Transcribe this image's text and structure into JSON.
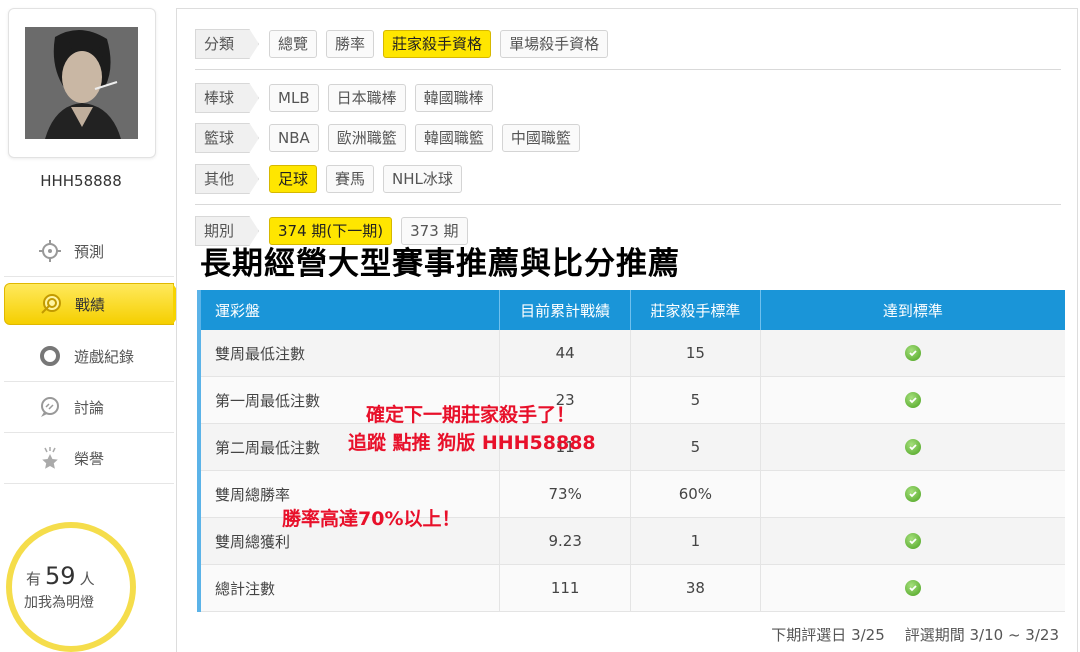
{
  "user": {
    "name": "HHH58888"
  },
  "sidebar": {
    "items": [
      {
        "label": "預測",
        "icon": "crosshair-icon",
        "active": false
      },
      {
        "label": "戰績",
        "icon": "target-icon",
        "active": true
      },
      {
        "label": "遊戲紀錄",
        "icon": "ring-icon",
        "active": false
      },
      {
        "label": "討論",
        "icon": "chat-icon",
        "active": false
      },
      {
        "label": "榮譽",
        "icon": "star-icon",
        "active": false
      }
    ],
    "fans": {
      "prefix": "有",
      "count": "59",
      "suffix": "人",
      "line2": "加我為明燈"
    }
  },
  "filters": {
    "category": {
      "label": "分類",
      "options": [
        "總覽",
        "勝率",
        "莊家殺手資格",
        "單場殺手資格"
      ],
      "selected": "莊家殺手資格"
    },
    "baseball": {
      "label": "棒球",
      "options": [
        "MLB",
        "日本職棒",
        "韓國職棒"
      ]
    },
    "basketball": {
      "label": "籃球",
      "options": [
        "NBA",
        "歐洲職籃",
        "韓國職籃",
        "中國職籃"
      ]
    },
    "other": {
      "label": "其他",
      "options": [
        "足球",
        "賽馬",
        "NHL冰球"
      ],
      "selected": "足球"
    },
    "period": {
      "label": "期別",
      "options": [
        "374 期(下一期)",
        "373 期"
      ],
      "selected": "374 期(下一期)"
    }
  },
  "headline": "長期經營大型賽事推薦與比分推薦",
  "table": {
    "headers": [
      "運彩盤",
      "目前累計戰績",
      "莊家殺手標準",
      "達到標準"
    ],
    "rows": [
      {
        "name": "雙周最低注數",
        "current": "44",
        "standard": "15"
      },
      {
        "name": "第一周最低注數",
        "current": "23",
        "standard": "5"
      },
      {
        "name": "第二周最低注數",
        "current": "11",
        "standard": "5"
      },
      {
        "name": "雙周總勝率",
        "current": "73%",
        "standard": "60%"
      },
      {
        "name": "雙周總獲利",
        "current": "9.23",
        "standard": "1"
      },
      {
        "name": "總計注數",
        "current": "111",
        "standard": "38"
      }
    ]
  },
  "overlay": {
    "line1": "確定下一期莊家殺手了！",
    "line2": "追蹤 點推 狗版 HHH58888",
    "line3": "勝率高達70%以上！",
    "color": "#e8102a"
  },
  "footer": {
    "next_date": "下期評選日 3/25",
    "period": "評選期間 3/10 ~ 3/23"
  },
  "colors": {
    "accent_yellow": "#ffe600",
    "table_header": "#1a95d8",
    "check_green": "#4aa11f"
  }
}
